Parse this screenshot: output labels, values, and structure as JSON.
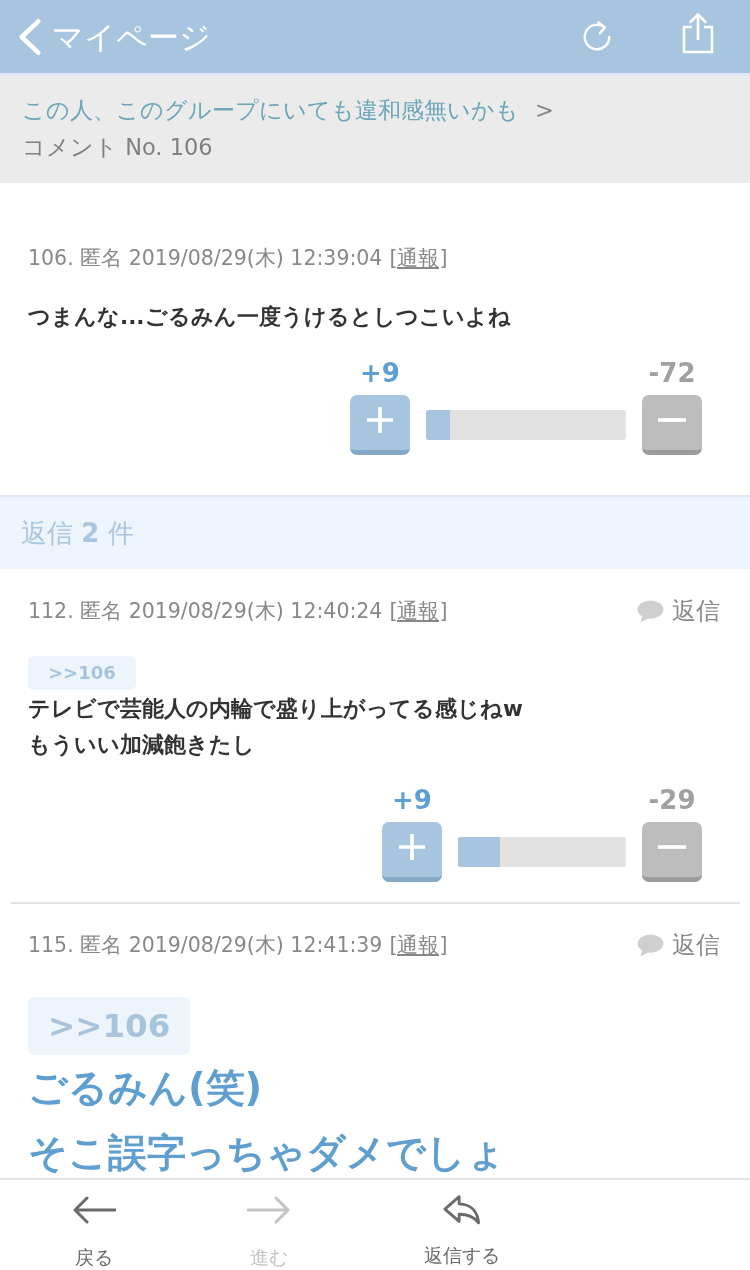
{
  "header": {
    "back_label": "マイページ"
  },
  "breadcrumb": {
    "link": "この人、このグループにいても違和感無いかも",
    "separator": ">",
    "current": "コメント No. 106"
  },
  "comment": {
    "meta": "106. 匿名 2019/08/29(木) 12:39:04",
    "report": "[通報]",
    "body": "つまんな...ごるみん一度うけるとしつこいよね",
    "plus": "+9",
    "minus": "-72",
    "level": 0.12
  },
  "replies_header": "返信 **2** 件",
  "replies": [
    {
      "kind": "normal",
      "meta": "112. 匿名 2019/08/29(木) 12:40:24",
      "report": "[通報]",
      "reply": "返信",
      "quote": ">>106",
      "body": "テレビで芸能人の内輪で盛り上がってる感じねw\nもういい加減飽きたし",
      "plus": "+9",
      "minus": "-29",
      "level": 0.25
    },
    {
      "kind": "large",
      "meta": "115. 匿名 2019/08/29(木) 12:41:39",
      "report": "[通報]",
      "reply": "返信",
      "quote": ">>106",
      "body": "ごるみん(笑)\nそこ誤字っちゃダメでしょ"
    }
  ],
  "toolbar": [
    {
      "kind": "back",
      "label": "戻る",
      "disabled": false
    },
    {
      "kind": "forward",
      "label": "進む",
      "disabled": true
    },
    {
      "kind": "reply",
      "label": "返信する",
      "disabled": false
    }
  ]
}
